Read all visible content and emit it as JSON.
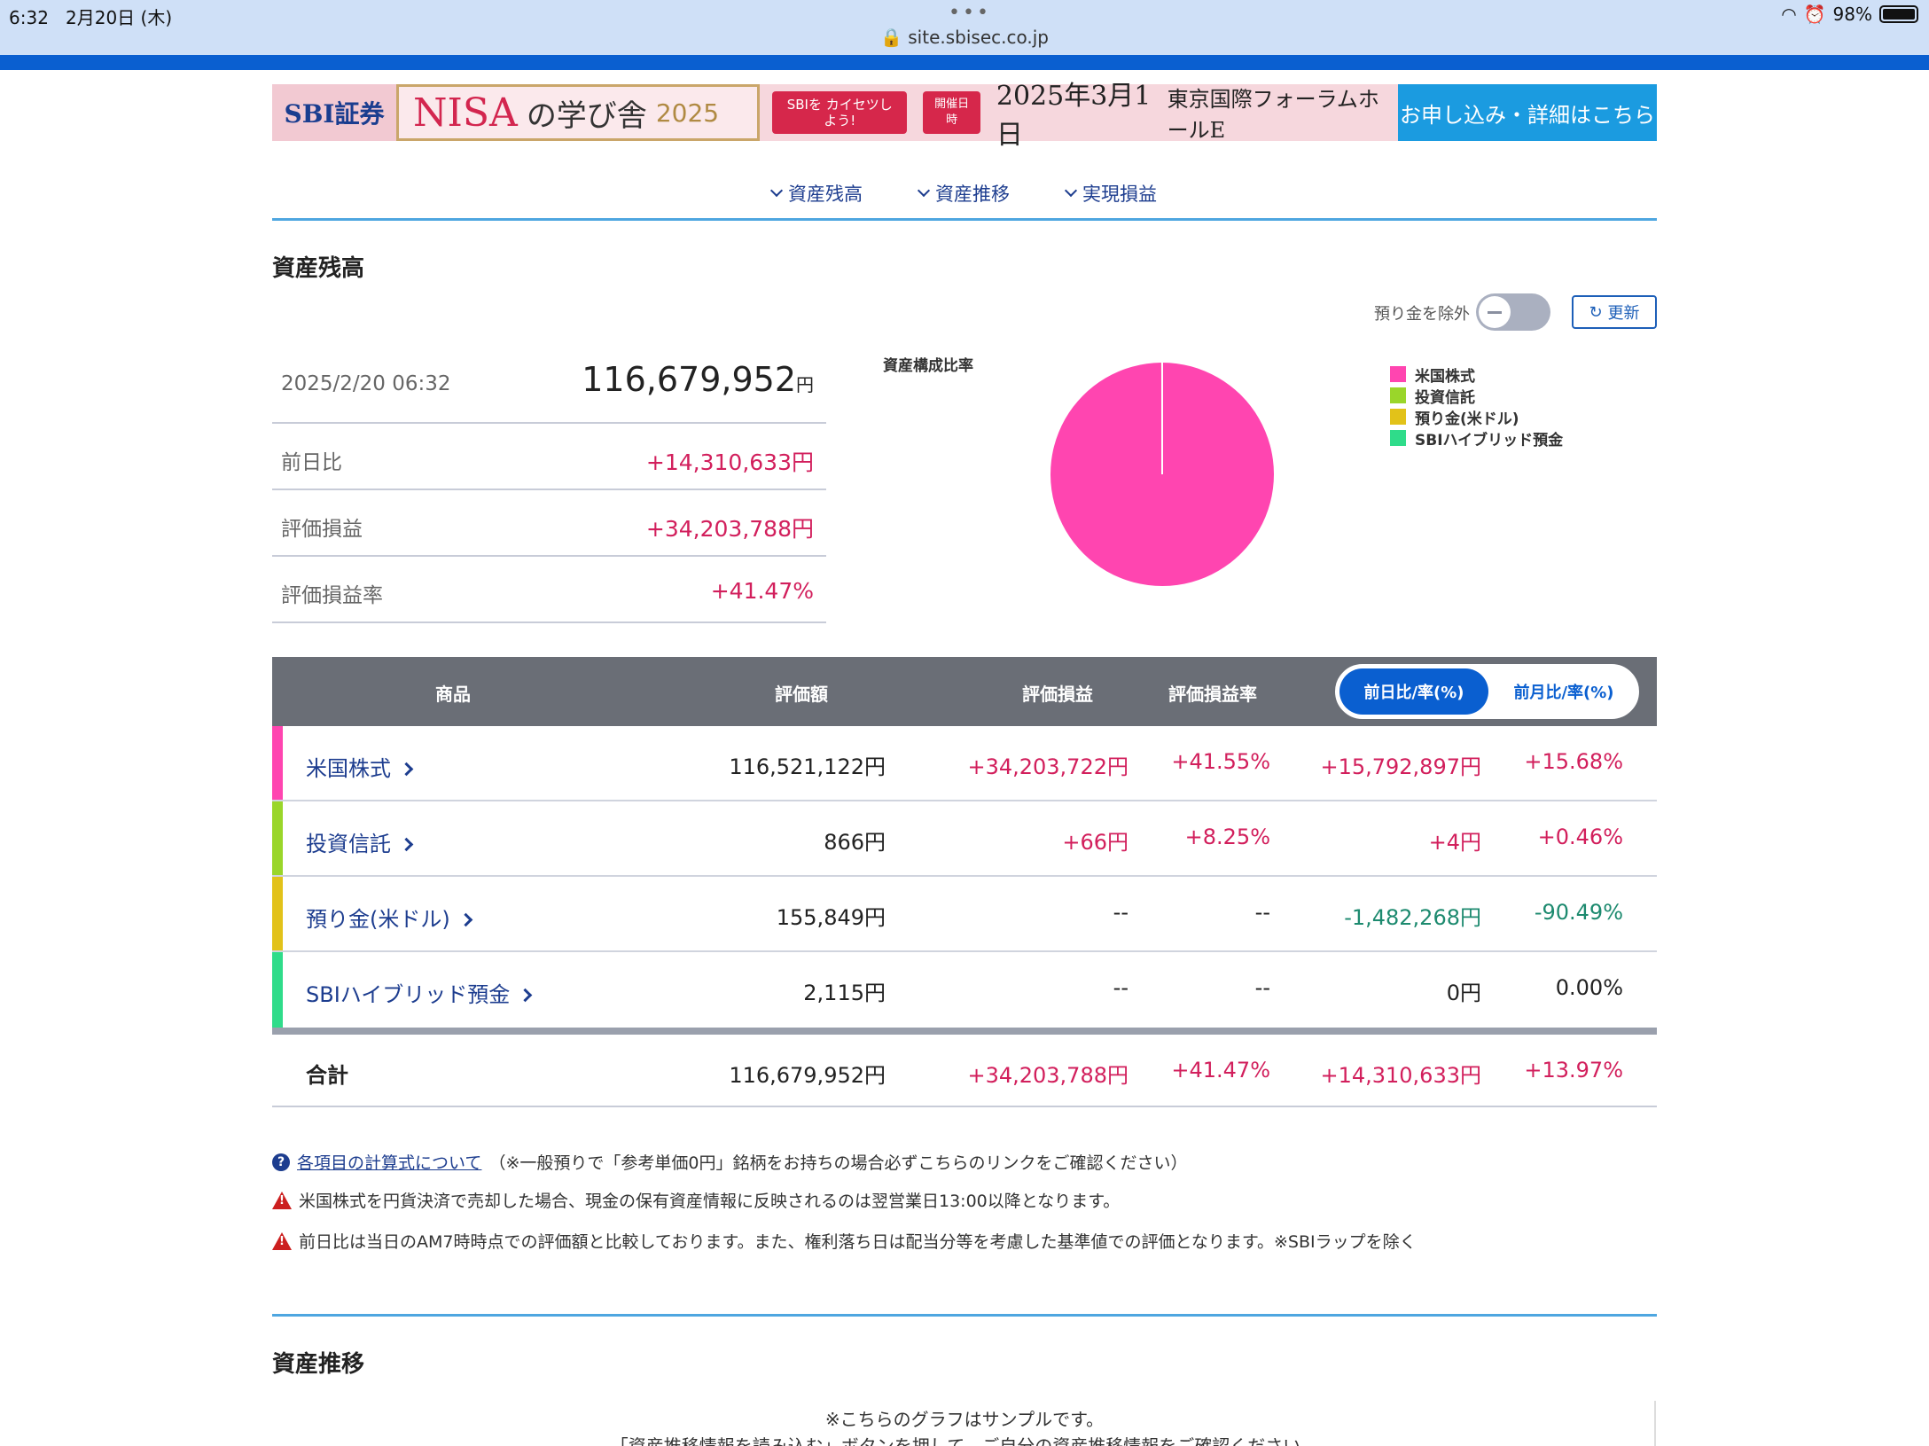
{
  "status": {
    "time": "6:32",
    "date": "2月20日 (木)",
    "battery": "98%"
  },
  "browser": {
    "url": "site.sbisec.co.jp"
  },
  "banner": {
    "logo": "SBI証券",
    "nisa": "NISA",
    "school": "の学び舎",
    "year": "2025",
    "pill1": "SBIを カイセツしよう!",
    "pill2": "開催日時",
    "date": "2025年3月1日",
    "venue": "東京国際フォーラムホールE",
    "cta": "お申し込み・詳細はこちら"
  },
  "nav": {
    "items": [
      "資産残高",
      "資産推移",
      "実現損益"
    ]
  },
  "section1": {
    "title": "資産残高",
    "exclude_label": "預り金を除外",
    "refresh_label": "更新",
    "timestamp": "2025/2/20 06:32",
    "total": "116,679,952",
    "total_unit": "円",
    "rows": [
      {
        "label": "前日比",
        "value": "+14,310,633円"
      },
      {
        "label": "評価損益",
        "value": "+34,203,788円"
      },
      {
        "label": "評価損益率",
        "value": "+41.47%"
      }
    ],
    "pie_title": "資産構成比率",
    "legend": [
      {
        "label": "米国株式",
        "color": "#ff45b0"
      },
      {
        "label": "投資信託",
        "color": "#9ad62a"
      },
      {
        "label": "預り金(米ドル)",
        "color": "#e2c219"
      },
      {
        "label": "SBIハイブリッド預金",
        "color": "#2fdc8a"
      }
    ],
    "pie_shares": [
      0.9986,
      0.0,
      0.0013,
      0.0001
    ]
  },
  "table": {
    "headers": {
      "product": "商品",
      "value": "評価額",
      "pl": "評価損益",
      "plr": "評価損益率"
    },
    "seg_active": "前日比/率(%)",
    "seg_inactive": "前月比/率(%)",
    "rows": [
      {
        "name": "米国株式",
        "color": "#ff45b0",
        "value": "116,521,122円",
        "pl": "+34,203,722円",
        "plr": "+41.55%",
        "day": "+15,792,897円",
        "dayr": "+15.68%",
        "pl_c": "pos",
        "day_c": "pos"
      },
      {
        "name": "投資信託",
        "color": "#9ad62a",
        "value": "866円",
        "pl": "+66円",
        "plr": "+8.25%",
        "day": "+4円",
        "dayr": "+0.46%",
        "pl_c": "pos",
        "day_c": "pos"
      },
      {
        "name": "預り金(米ドル)",
        "color": "#e2c219",
        "value": "155,849円",
        "pl": "--",
        "plr": "--",
        "day": "-1,482,268円",
        "dayr": "-90.49%",
        "pl_c": "neu",
        "day_c": "neg"
      },
      {
        "name": "SBIハイブリッド預金",
        "color": "#2fdc8a",
        "value": "2,115円",
        "pl": "--",
        "plr": "--",
        "day": "0円",
        "dayr": "0.00%",
        "pl_c": "neu",
        "day_c": "neu"
      }
    ],
    "total": {
      "name": "合計",
      "value": "116,679,952円",
      "pl": "+34,203,788円",
      "plr": "+41.47%",
      "day": "+14,310,633円",
      "dayr": "+13.97%"
    }
  },
  "notes": {
    "link": "各項目の計算式について",
    "link_suffix": "（※一般預りで「参考単価0円」銘柄をお持ちの場合必ずこちらのリンクをご確認ください）",
    "warn1": "米国株式を円貨決済で売却した場合、現金の保有資産情報に反映されるのは翌営業日13:00以降となります。",
    "warn2": "前日比は当日のAM7時時点での評価額と比較しております。また、権利落ち日は配当分等を考慮した基準値での評価となります。※SBIラップを除く"
  },
  "section2": {
    "title": "資産推移",
    "sample1": "※こちらのグラフはサンプルです。",
    "sample2": "「資産推移情報を読み込む」ボタンを押して、ご自分の資産推移情報をご確認ください。"
  }
}
